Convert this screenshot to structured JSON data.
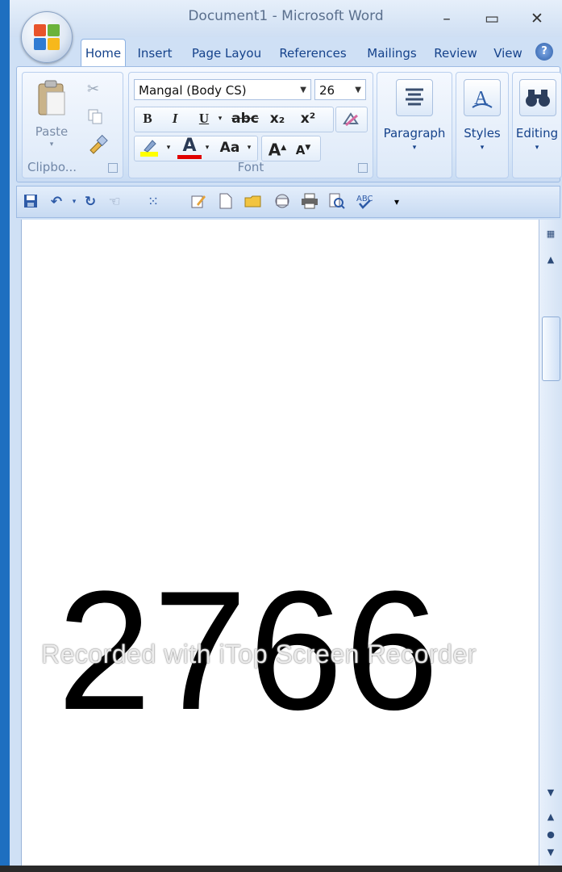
{
  "window": {
    "title": "Document1 - Microsoft Word",
    "controls": {
      "minimize": "–",
      "maximize": "▭",
      "close": "✕"
    }
  },
  "tabs": [
    {
      "label": "Home",
      "active": true
    },
    {
      "label": "Insert"
    },
    {
      "label": "Page Layou"
    },
    {
      "label": "References"
    },
    {
      "label": "Mailings"
    },
    {
      "label": "Review"
    },
    {
      "label": "View"
    }
  ],
  "help_label": "?",
  "ribbon": {
    "clipboard": {
      "paste_label": "Paste",
      "group_label": "Clipbo..."
    },
    "font": {
      "font_name": "Mangal (Body CS)",
      "font_size": "26",
      "group_label": "Font",
      "buttons": {
        "bold": "B",
        "italic": "I",
        "underline": "U",
        "strike": "abc",
        "subscript": "x₂",
        "superscript": "x²",
        "font_color": "A",
        "change_case": "Aa",
        "grow": "A",
        "shrink": "A"
      }
    },
    "paragraph": {
      "label": "Paragraph"
    },
    "styles": {
      "label": "Styles"
    },
    "editing": {
      "label": "Editing"
    }
  },
  "document": {
    "text": "2766",
    "watermark": "Recorded with iTop Screen Recorder"
  },
  "colors": {
    "accent": "#15428b",
    "highlight": "#ffff00",
    "font_color": "#e00000"
  }
}
